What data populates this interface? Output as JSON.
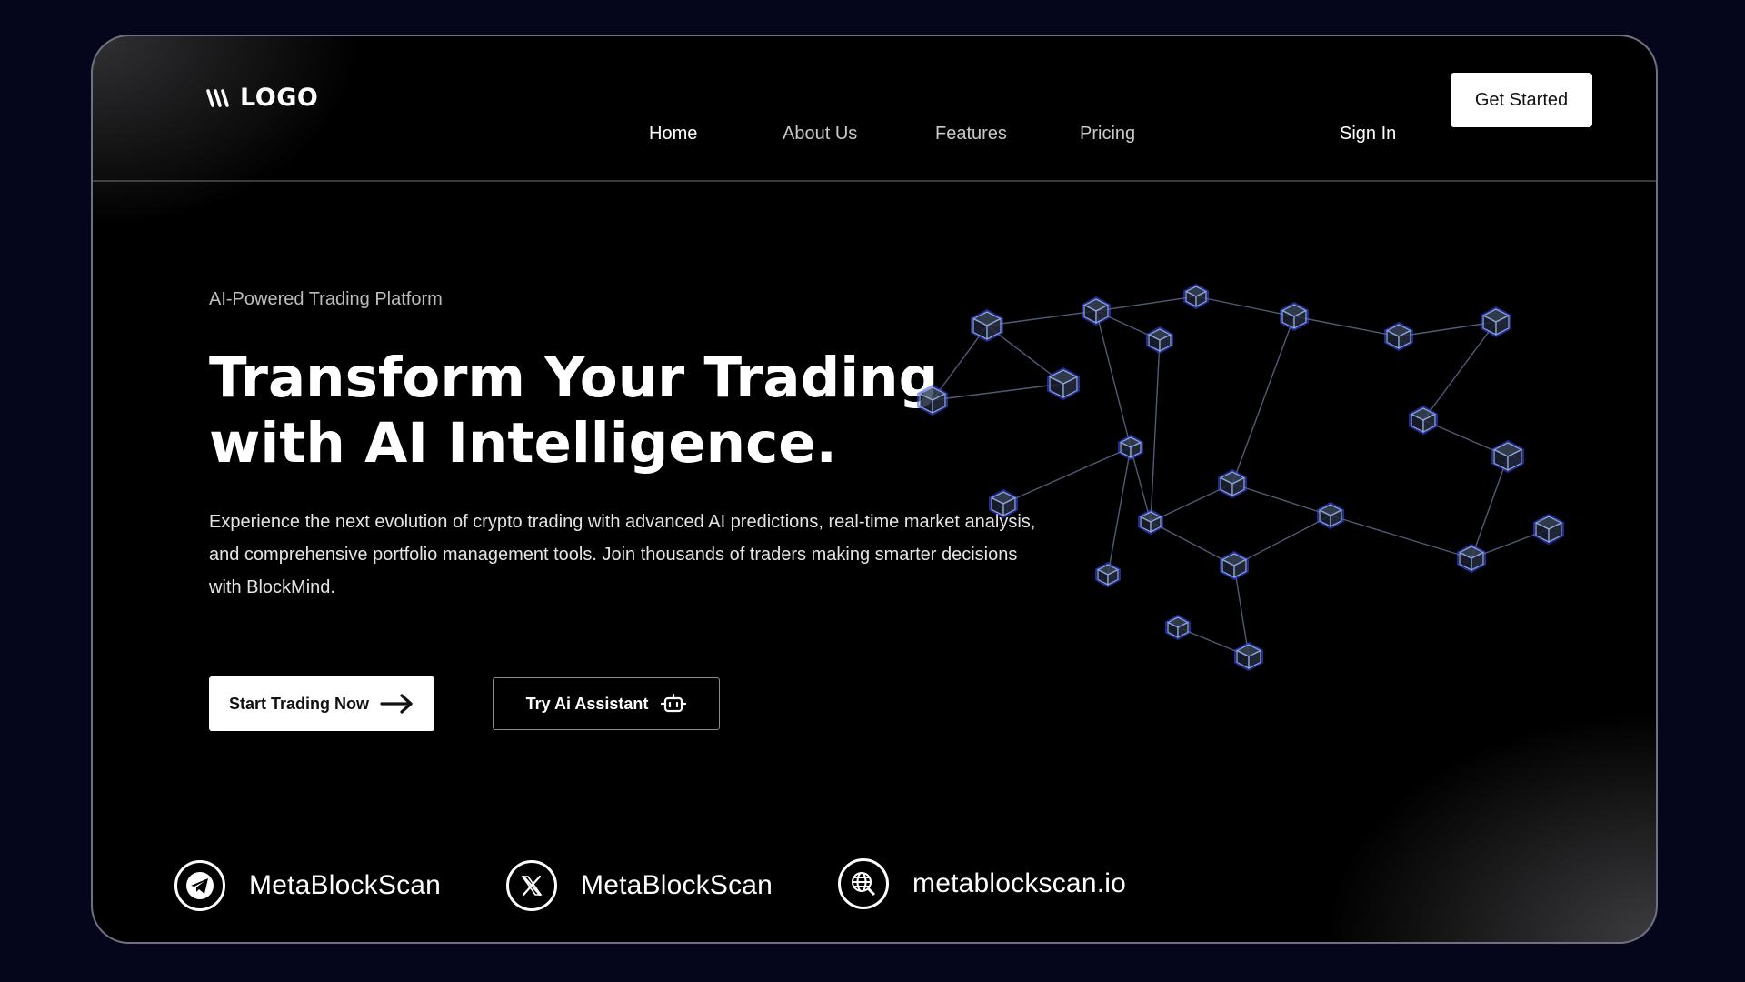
{
  "header": {
    "logo_text": "LOGO",
    "nav": [
      {
        "label": "Home",
        "active": true
      },
      {
        "label": "About Us",
        "active": false
      },
      {
        "label": "Features",
        "active": false
      },
      {
        "label": "Pricing",
        "active": false
      }
    ],
    "sign_in_label": "Sign In",
    "get_started_label": "Get Started"
  },
  "hero": {
    "eyebrow": "AI-Powered Trading Platform",
    "title_line1": "Transform Your Trading",
    "title_line2": "with AI Intelligence.",
    "description": "Experience the next evolution of crypto trading with advanced AI predictions, real-time market analysis, and comprehensive portfolio management tools. Join thousands of traders making smarter decisions with BlockMind.",
    "primary_button": "Start Trading Now",
    "secondary_button": "Try Ai Assistant",
    "image_icon": "blockchain-network-illustration"
  },
  "socials": [
    {
      "icon": "telegram-icon",
      "label": "MetaBlockScan"
    },
    {
      "icon": "x-icon",
      "label": "MetaBlockScan"
    },
    {
      "icon": "globe-icon",
      "label": "metablockscan.io"
    }
  ],
  "colors": {
    "page_background": "#05061c",
    "card_background": "#000000",
    "text_primary": "#ffffff",
    "text_muted": "#bdbdbd",
    "cube_stroke": "#8fa6d6",
    "cube_glow": "#3d4fff"
  }
}
